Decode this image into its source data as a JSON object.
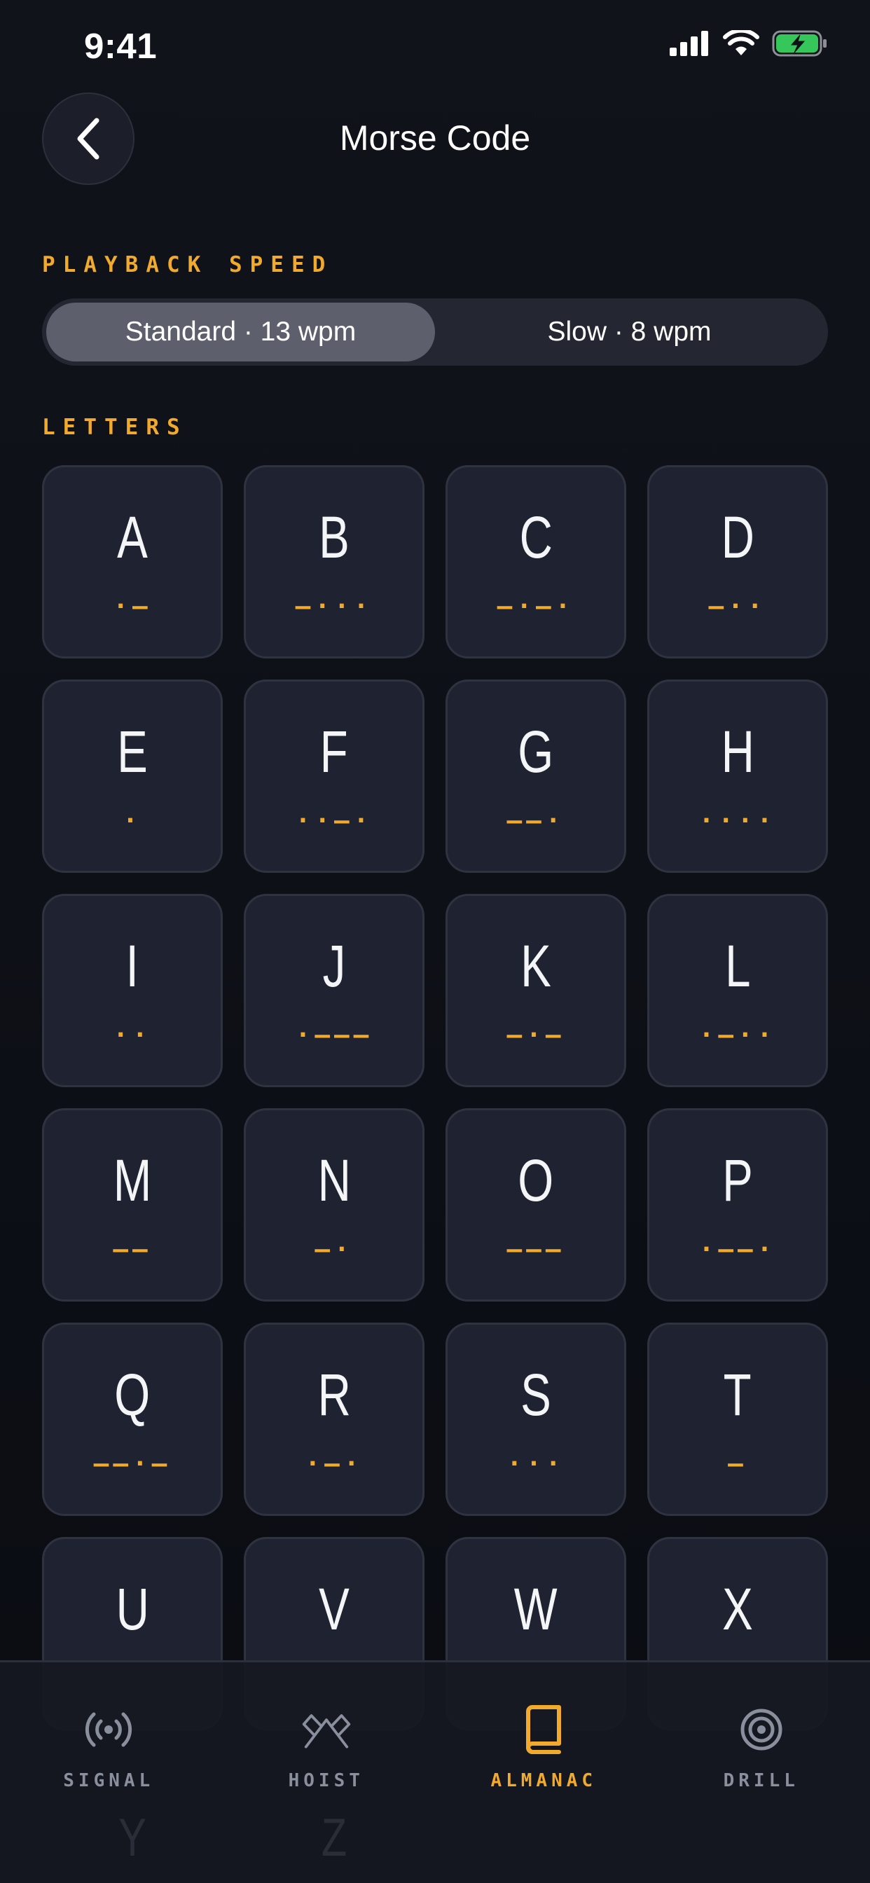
{
  "status_bar": {
    "time": "9:41"
  },
  "header": {
    "title": "Morse Code"
  },
  "speed": {
    "label": "PLAYBACK SPEED",
    "options": [
      "Standard · 13 wpm",
      "Slow · 8 wpm"
    ],
    "selected": "Standard · 13 wpm"
  },
  "letters_section": {
    "label": "LETTERS",
    "cards": [
      {
        "letter": "A",
        "code": ".-"
      },
      {
        "letter": "B",
        "code": "-..."
      },
      {
        "letter": "C",
        "code": "-.-."
      },
      {
        "letter": "D",
        "code": "-.."
      },
      {
        "letter": "E",
        "code": "."
      },
      {
        "letter": "F",
        "code": "..-."
      },
      {
        "letter": "G",
        "code": "--."
      },
      {
        "letter": "H",
        "code": "...."
      },
      {
        "letter": "I",
        "code": ".."
      },
      {
        "letter": "J",
        "code": ".---"
      },
      {
        "letter": "K",
        "code": "-.-"
      },
      {
        "letter": "L",
        "code": ".-.."
      },
      {
        "letter": "M",
        "code": "--"
      },
      {
        "letter": "N",
        "code": "-."
      },
      {
        "letter": "O",
        "code": "---"
      },
      {
        "letter": "P",
        "code": ".--."
      },
      {
        "letter": "Q",
        "code": "--.-"
      },
      {
        "letter": "R",
        "code": ".-."
      },
      {
        "letter": "S",
        "code": "..."
      },
      {
        "letter": "T",
        "code": "-"
      },
      {
        "letter": "U",
        "code": ""
      },
      {
        "letter": "V",
        "code": ""
      },
      {
        "letter": "W",
        "code": ""
      },
      {
        "letter": "X",
        "code": ""
      }
    ],
    "partially_hidden": [
      "Y",
      "Z"
    ]
  },
  "tabbar": {
    "tabs": [
      {
        "label": "SIGNAL",
        "icon": "broadcast-icon",
        "active": false
      },
      {
        "label": "HOIST",
        "icon": "crossed-flags-icon",
        "active": false
      },
      {
        "label": "ALMANAC",
        "icon": "book-icon",
        "active": true
      },
      {
        "label": "DRILL",
        "icon": "target-icon",
        "active": false
      }
    ]
  },
  "colors": {
    "accent": "#f2aa2c",
    "background": "#0f1118",
    "card": "#1f2230",
    "segment_active": "#5d606c"
  }
}
